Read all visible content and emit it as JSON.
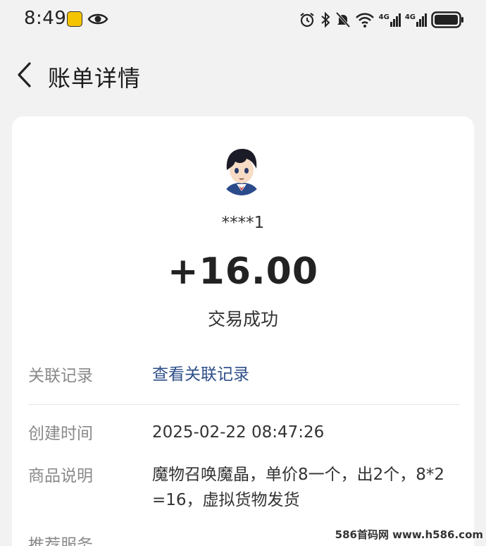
{
  "status_bar": {
    "time": "8:49",
    "network_1": "4G",
    "network_2": "4G"
  },
  "nav": {
    "title": "账单详情"
  },
  "summary": {
    "account_name": "****1",
    "amount": "+16.00",
    "status": "交易成功"
  },
  "details": {
    "related_label": "关联记录",
    "related_value": "查看关联记录",
    "created_label": "创建时间",
    "created_value": "2025-02-22 08:47:26",
    "desc_label": "商品说明",
    "desc_value": "魔物召唤魔晶，单价8一个，出2个，8*2=16，虚拟货物发货",
    "service_label": "推荐服务"
  },
  "watermark": "586首码网 www.h586.com",
  "colors": {
    "background": "#f2f2f2",
    "card": "#ffffff",
    "link": "#2f4f8a",
    "label": "#8a8a8a"
  }
}
